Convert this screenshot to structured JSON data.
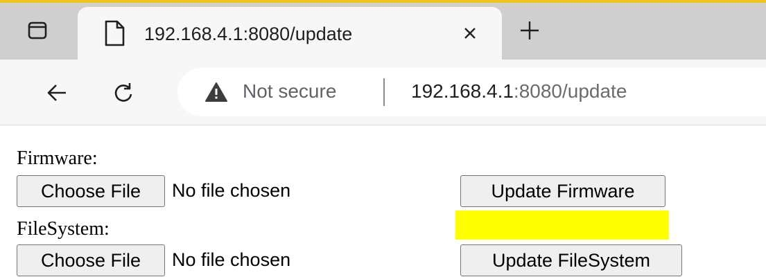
{
  "browser": {
    "tab": {
      "title": "192.168.4.1:8080/update",
      "close_glyph": "×",
      "favicon": "page-icon"
    },
    "new_tab_glyph": "+",
    "tab_actions_icon": "tab-actions-icon",
    "toolbar": {
      "back_icon": "back-arrow-icon",
      "reload_icon": "reload-icon"
    },
    "omnibox": {
      "security_icon": "warning-icon",
      "security_text": "Not secure",
      "separator": "|",
      "url_host": "192.168.4.1",
      "url_rest": ":8080/update"
    },
    "colors": {
      "accent": "#f0c419",
      "tab_strip": "#cfcfcf",
      "toolbar": "#f7f7f7",
      "highlight": "#ffff00"
    }
  },
  "page": {
    "firmware": {
      "label": "Firmware:",
      "choose_button": "Choose File",
      "file_status": "No file chosen",
      "update_button": "Update Firmware"
    },
    "filesystem": {
      "label": "FileSystem:",
      "choose_button": "Choose File",
      "file_status": "No file chosen",
      "update_button": "Update FileSystem"
    }
  }
}
